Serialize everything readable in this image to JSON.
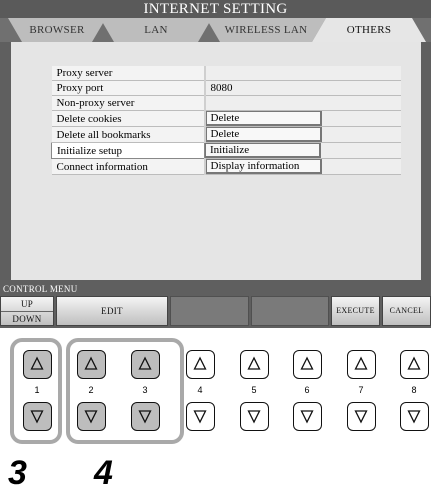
{
  "window": {
    "title": "INTERNET SETTING"
  },
  "tabs": [
    {
      "label": "BROWSER"
    },
    {
      "label": "LAN"
    },
    {
      "label": "WIRELESS LAN"
    },
    {
      "label": "OTHERS",
      "active": true
    }
  ],
  "settings": [
    {
      "label": "Proxy server",
      "value": ""
    },
    {
      "label": "Proxy port",
      "value": "8080"
    },
    {
      "label": "Non-proxy server",
      "value": ""
    },
    {
      "label": "Delete cookies",
      "button": "Delete"
    },
    {
      "label": "Delete all bookmarks",
      "button": "Delete"
    },
    {
      "label": "Initialize setup",
      "button": "Initialize"
    },
    {
      "label": "Connect information",
      "button": "Display information"
    }
  ],
  "control_menu": {
    "label": "CONTROL MENU",
    "up": "UP",
    "down": "DOWN",
    "edit": "EDIT",
    "execute": "EXECUTE",
    "cancel": "CANCEL"
  },
  "buttons": {
    "numbers": [
      "1",
      "2",
      "3",
      "4",
      "5",
      "6",
      "7",
      "8"
    ],
    "up_icon": "triangle-up-icon",
    "down_icon": "triangle-down-icon"
  },
  "steps": [
    "3",
    "4"
  ]
}
